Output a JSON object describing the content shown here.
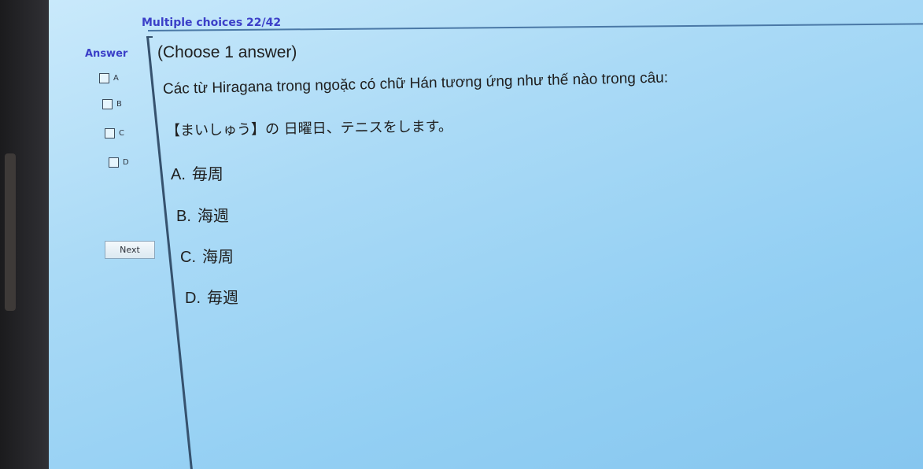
{
  "header": {
    "title": "Multiple choices 22/42"
  },
  "sidebar": {
    "answer_label": "Answer",
    "options": [
      {
        "letter": "A",
        "checked": false
      },
      {
        "letter": "B",
        "checked": false
      },
      {
        "letter": "C",
        "checked": false
      },
      {
        "letter": "D",
        "checked": false
      }
    ],
    "next_label": "Next"
  },
  "question": {
    "instruction": "(Choose 1 answer)",
    "prompt": "Các từ Hiragana trong ngoặc có chữ Hán tương ứng như thế nào trong câu:",
    "sentence": "【まいしゅう】の 日曜日、テニスをします。",
    "choices": [
      {
        "letter": "A.",
        "text": "毎周"
      },
      {
        "letter": "B.",
        "text": "海週"
      },
      {
        "letter": "C.",
        "text": "海周"
      },
      {
        "letter": "D.",
        "text": "毎週"
      }
    ]
  }
}
